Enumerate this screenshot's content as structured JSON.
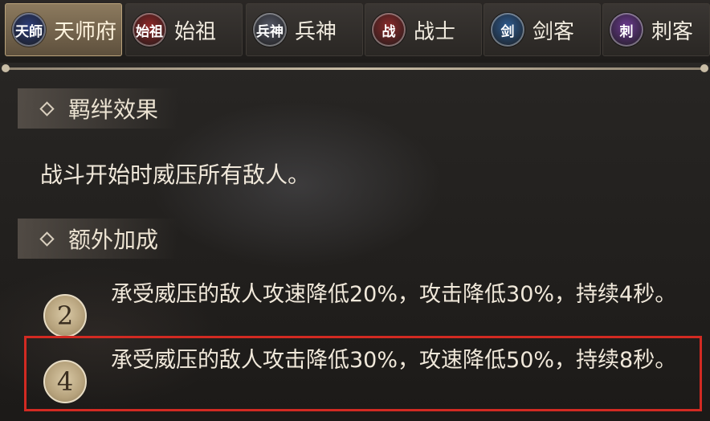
{
  "tabs": [
    {
      "label": "天师府",
      "emblem": "天師",
      "color": "#2c3d78",
      "active": true
    },
    {
      "label": "始祖",
      "emblem": "始祖",
      "color": "#8f2626",
      "active": false
    },
    {
      "label": "兵神",
      "emblem": "兵神",
      "color": "#555866",
      "active": false
    },
    {
      "label": "战士",
      "emblem": "战",
      "color": "#8b2a2a",
      "active": false
    },
    {
      "label": "剑客",
      "emblem": "剑",
      "color": "#2e5b8f",
      "active": false
    },
    {
      "label": "刺客",
      "emblem": "刺",
      "color": "#6b3a8f",
      "active": false
    }
  ],
  "bond": {
    "header": "羁绊效果",
    "description": "战斗开始时威压所有敌人。"
  },
  "extra": {
    "header": "额外加成",
    "bonuses": [
      {
        "count": "2",
        "text": "承受威压的敌人攻速降低20%，攻击降低30%，持续4秒。"
      },
      {
        "count": "4",
        "text": "承受威压的敌人攻击降低30%，攻速降低50%，持续8秒。"
      }
    ]
  }
}
